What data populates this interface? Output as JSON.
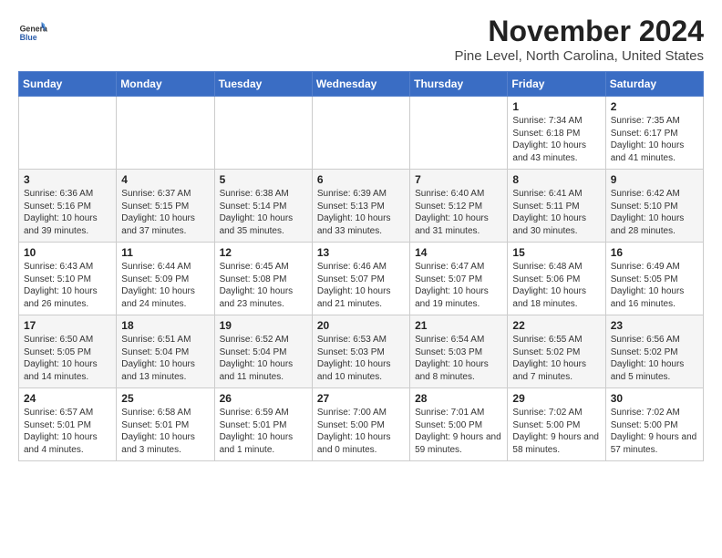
{
  "header": {
    "logo_general": "General",
    "logo_blue": "Blue",
    "month": "November 2024",
    "location": "Pine Level, North Carolina, United States"
  },
  "weekdays": [
    "Sunday",
    "Monday",
    "Tuesday",
    "Wednesday",
    "Thursday",
    "Friday",
    "Saturday"
  ],
  "weeks": [
    [
      {
        "day": "",
        "text": ""
      },
      {
        "day": "",
        "text": ""
      },
      {
        "day": "",
        "text": ""
      },
      {
        "day": "",
        "text": ""
      },
      {
        "day": "",
        "text": ""
      },
      {
        "day": "1",
        "text": "Sunrise: 7:34 AM\nSunset: 6:18 PM\nDaylight: 10 hours and 43 minutes."
      },
      {
        "day": "2",
        "text": "Sunrise: 7:35 AM\nSunset: 6:17 PM\nDaylight: 10 hours and 41 minutes."
      }
    ],
    [
      {
        "day": "3",
        "text": "Sunrise: 6:36 AM\nSunset: 5:16 PM\nDaylight: 10 hours and 39 minutes."
      },
      {
        "day": "4",
        "text": "Sunrise: 6:37 AM\nSunset: 5:15 PM\nDaylight: 10 hours and 37 minutes."
      },
      {
        "day": "5",
        "text": "Sunrise: 6:38 AM\nSunset: 5:14 PM\nDaylight: 10 hours and 35 minutes."
      },
      {
        "day": "6",
        "text": "Sunrise: 6:39 AM\nSunset: 5:13 PM\nDaylight: 10 hours and 33 minutes."
      },
      {
        "day": "7",
        "text": "Sunrise: 6:40 AM\nSunset: 5:12 PM\nDaylight: 10 hours and 31 minutes."
      },
      {
        "day": "8",
        "text": "Sunrise: 6:41 AM\nSunset: 5:11 PM\nDaylight: 10 hours and 30 minutes."
      },
      {
        "day": "9",
        "text": "Sunrise: 6:42 AM\nSunset: 5:10 PM\nDaylight: 10 hours and 28 minutes."
      }
    ],
    [
      {
        "day": "10",
        "text": "Sunrise: 6:43 AM\nSunset: 5:10 PM\nDaylight: 10 hours and 26 minutes."
      },
      {
        "day": "11",
        "text": "Sunrise: 6:44 AM\nSunset: 5:09 PM\nDaylight: 10 hours and 24 minutes."
      },
      {
        "day": "12",
        "text": "Sunrise: 6:45 AM\nSunset: 5:08 PM\nDaylight: 10 hours and 23 minutes."
      },
      {
        "day": "13",
        "text": "Sunrise: 6:46 AM\nSunset: 5:07 PM\nDaylight: 10 hours and 21 minutes."
      },
      {
        "day": "14",
        "text": "Sunrise: 6:47 AM\nSunset: 5:07 PM\nDaylight: 10 hours and 19 minutes."
      },
      {
        "day": "15",
        "text": "Sunrise: 6:48 AM\nSunset: 5:06 PM\nDaylight: 10 hours and 18 minutes."
      },
      {
        "day": "16",
        "text": "Sunrise: 6:49 AM\nSunset: 5:05 PM\nDaylight: 10 hours and 16 minutes."
      }
    ],
    [
      {
        "day": "17",
        "text": "Sunrise: 6:50 AM\nSunset: 5:05 PM\nDaylight: 10 hours and 14 minutes."
      },
      {
        "day": "18",
        "text": "Sunrise: 6:51 AM\nSunset: 5:04 PM\nDaylight: 10 hours and 13 minutes."
      },
      {
        "day": "19",
        "text": "Sunrise: 6:52 AM\nSunset: 5:04 PM\nDaylight: 10 hours and 11 minutes."
      },
      {
        "day": "20",
        "text": "Sunrise: 6:53 AM\nSunset: 5:03 PM\nDaylight: 10 hours and 10 minutes."
      },
      {
        "day": "21",
        "text": "Sunrise: 6:54 AM\nSunset: 5:03 PM\nDaylight: 10 hours and 8 minutes."
      },
      {
        "day": "22",
        "text": "Sunrise: 6:55 AM\nSunset: 5:02 PM\nDaylight: 10 hours and 7 minutes."
      },
      {
        "day": "23",
        "text": "Sunrise: 6:56 AM\nSunset: 5:02 PM\nDaylight: 10 hours and 5 minutes."
      }
    ],
    [
      {
        "day": "24",
        "text": "Sunrise: 6:57 AM\nSunset: 5:01 PM\nDaylight: 10 hours and 4 minutes."
      },
      {
        "day": "25",
        "text": "Sunrise: 6:58 AM\nSunset: 5:01 PM\nDaylight: 10 hours and 3 minutes."
      },
      {
        "day": "26",
        "text": "Sunrise: 6:59 AM\nSunset: 5:01 PM\nDaylight: 10 hours and 1 minute."
      },
      {
        "day": "27",
        "text": "Sunrise: 7:00 AM\nSunset: 5:00 PM\nDaylight: 10 hours and 0 minutes."
      },
      {
        "day": "28",
        "text": "Sunrise: 7:01 AM\nSunset: 5:00 PM\nDaylight: 9 hours and 59 minutes."
      },
      {
        "day": "29",
        "text": "Sunrise: 7:02 AM\nSunset: 5:00 PM\nDaylight: 9 hours and 58 minutes."
      },
      {
        "day": "30",
        "text": "Sunrise: 7:02 AM\nSunset: 5:00 PM\nDaylight: 9 hours and 57 minutes."
      }
    ]
  ]
}
